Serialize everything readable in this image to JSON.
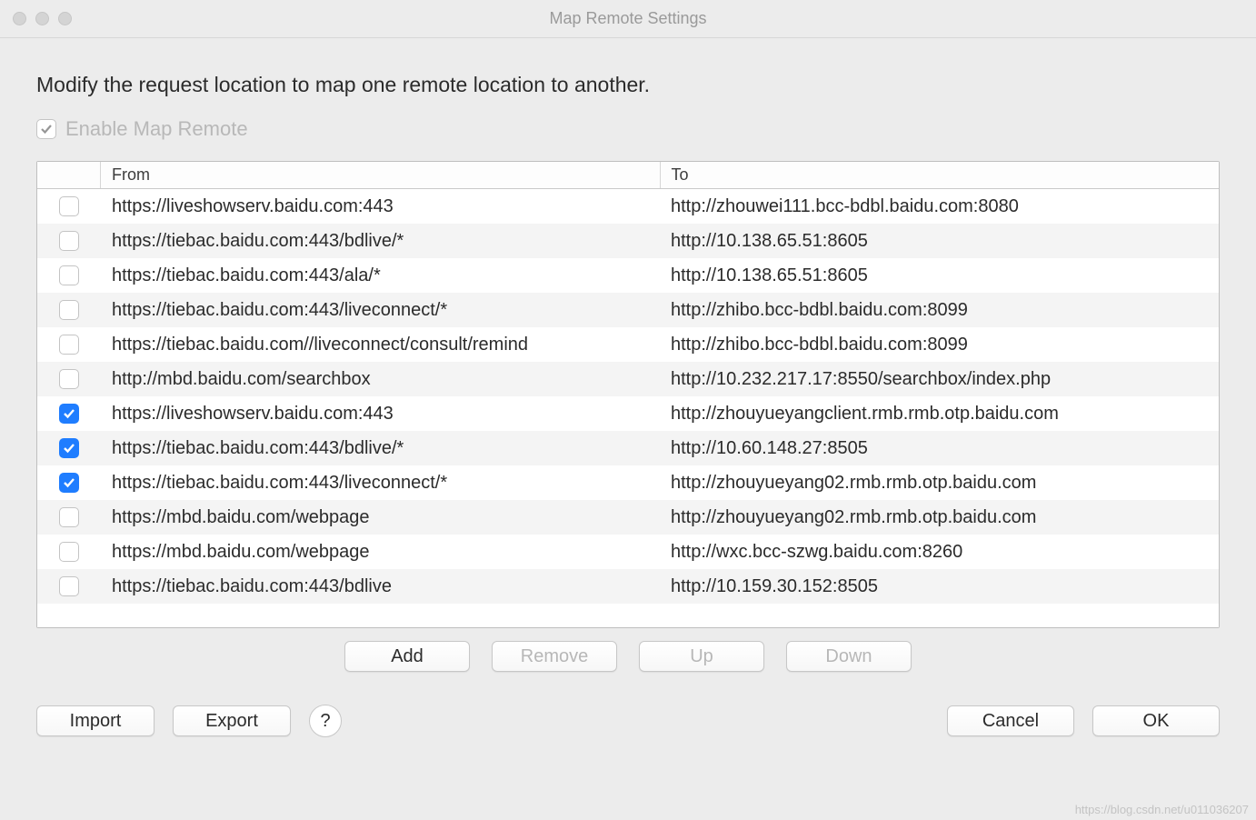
{
  "window": {
    "title": "Map Remote Settings"
  },
  "description": "Modify the request location to map one remote location to another.",
  "enable": {
    "label": "Enable Map Remote",
    "checked": true
  },
  "table": {
    "headers": {
      "from": "From",
      "to": "To"
    },
    "rows": [
      {
        "checked": false,
        "from": "https://liveshowserv.baidu.com:443",
        "to": "http://zhouwei111.bcc-bdbl.baidu.com:8080"
      },
      {
        "checked": false,
        "from": "https://tiebac.baidu.com:443/bdlive/*",
        "to": "http://10.138.65.51:8605"
      },
      {
        "checked": false,
        "from": "https://tiebac.baidu.com:443/ala/*",
        "to": "http://10.138.65.51:8605"
      },
      {
        "checked": false,
        "from": "https://tiebac.baidu.com:443/liveconnect/*",
        "to": "http://zhibo.bcc-bdbl.baidu.com:8099"
      },
      {
        "checked": false,
        "from": "https://tiebac.baidu.com//liveconnect/consult/remind",
        "to": "http://zhibo.bcc-bdbl.baidu.com:8099"
      },
      {
        "checked": false,
        "from": "http://mbd.baidu.com/searchbox",
        "to": "http://10.232.217.17:8550/searchbox/index.php"
      },
      {
        "checked": true,
        "from": "https://liveshowserv.baidu.com:443",
        "to": "http://zhouyueyangclient.rmb.rmb.otp.baidu.com"
      },
      {
        "checked": true,
        "from": "https://tiebac.baidu.com:443/bdlive/*",
        "to": "http://10.60.148.27:8505"
      },
      {
        "checked": true,
        "from": "https://tiebac.baidu.com:443/liveconnect/*",
        "to": "http://zhouyueyang02.rmb.rmb.otp.baidu.com"
      },
      {
        "checked": false,
        "from": "https://mbd.baidu.com/webpage",
        "to": "http://zhouyueyang02.rmb.rmb.otp.baidu.com"
      },
      {
        "checked": false,
        "from": "https://mbd.baidu.com/webpage",
        "to": "http://wxc.bcc-szwg.baidu.com:8260"
      },
      {
        "checked": false,
        "from": "https://tiebac.baidu.com:443/bdlive",
        "to": "http://10.159.30.152:8505"
      }
    ]
  },
  "buttons": {
    "add": "Add",
    "remove": "Remove",
    "up": "Up",
    "down": "Down",
    "import": "Import",
    "export": "Export",
    "help": "?",
    "cancel": "Cancel",
    "ok": "OK"
  },
  "watermark": "https://blog.csdn.net/u011036207"
}
